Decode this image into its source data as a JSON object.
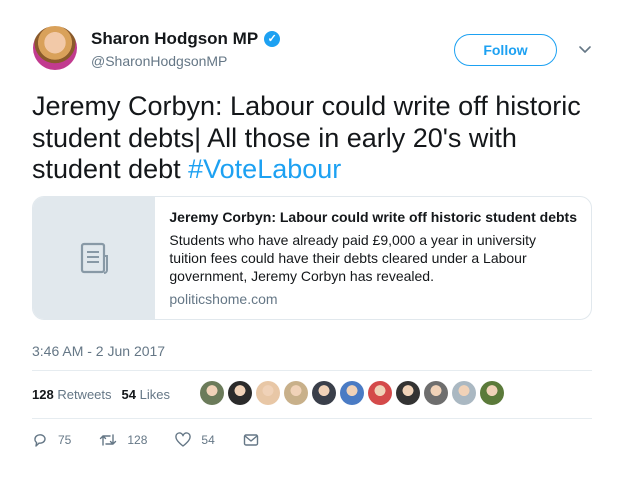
{
  "author": {
    "name": "Sharon Hodgson MP",
    "handle": "@SharonHodgsonMP",
    "verified": true
  },
  "follow_button": {
    "label": "Follow"
  },
  "tweet": {
    "text": "Jeremy Corbyn: Labour could write off historic student debts| All those in early 20's with student debt ",
    "hashtag": "#VoteLabour",
    "timestamp": "3:46 AM - 2 Jun 2017"
  },
  "card": {
    "title": "Jeremy Corbyn: Labour could write off historic student debts",
    "description": "Students who have already paid £9,000 a year in university tuition fees could have their debts cleared under a Labour government, Jeremy Corbyn has revealed.",
    "domain": "politicshome.com",
    "thumb_icon": "document-icon"
  },
  "stats": {
    "retweets_count": "128",
    "retweets_label": "Retweets",
    "likes_count": "54",
    "likes_label": "Likes"
  },
  "likers": [
    {
      "color": "#6b7b5a"
    },
    {
      "color": "#2b2b2b"
    },
    {
      "color": "#e8c7a6"
    },
    {
      "color": "#c8b08a"
    },
    {
      "color": "#3a3f4a"
    },
    {
      "color": "#4a7bc4"
    },
    {
      "color": "#d44a4a"
    },
    {
      "color": "#333333"
    },
    {
      "color": "#6e6e6e"
    },
    {
      "color": "#aab8c2"
    },
    {
      "color": "#5b7a3a"
    }
  ],
  "actions": {
    "replies": "75",
    "retweets": "128",
    "likes": "54"
  },
  "colors": {
    "accent": "#1da1f2",
    "secondary_text": "#657786",
    "border": "#e1e8ed"
  }
}
